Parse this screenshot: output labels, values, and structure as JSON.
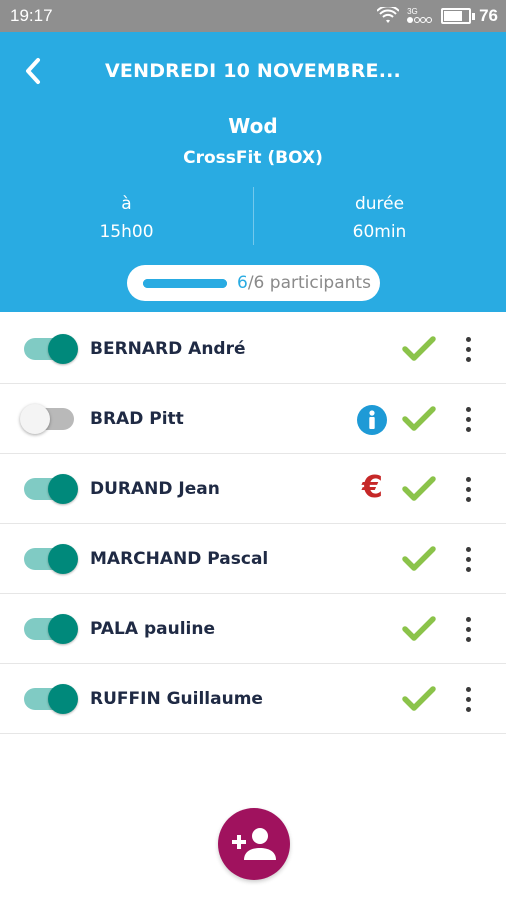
{
  "status_bar": {
    "time": "19:17",
    "network_label": "3G",
    "battery_percent": "76",
    "battery_level": 0.76
  },
  "header": {
    "back_icon": "chevron-left-icon",
    "title": "VENDREDI 10 NOVEMBRE...",
    "class_name": "Wod",
    "class_location": "CrossFit (BOX)",
    "start_label": "à",
    "start_value": "15h00",
    "duration_label": "durée",
    "duration_value": "60min",
    "participants_current": "6",
    "participants_rest": "/6 participants",
    "fill_fraction": 1.0,
    "background_color": "#29abe2"
  },
  "participants": [
    {
      "name": "BERNARD André",
      "active": true,
      "status_icon": "",
      "checked": true
    },
    {
      "name": "BRAD Pitt",
      "active": false,
      "status_icon": "info-icon",
      "checked": true
    },
    {
      "name": "DURAND Jean",
      "active": true,
      "status_icon": "euro-icon",
      "checked": true
    },
    {
      "name": "MARCHAND Pascal",
      "active": true,
      "status_icon": "",
      "checked": true
    },
    {
      "name": "PALA pauline",
      "active": true,
      "status_icon": "",
      "checked": true
    },
    {
      "name": "RUFFIN Guillaume",
      "active": true,
      "status_icon": "",
      "checked": true
    }
  ],
  "euro_symbol": "€",
  "fab": {
    "icon": "add-person-icon",
    "color": "#a0125e"
  },
  "colors": {
    "toggle_on": "#00897b",
    "check": "#8bc34a",
    "info": "#1e9ad6",
    "euro": "#c62828"
  }
}
